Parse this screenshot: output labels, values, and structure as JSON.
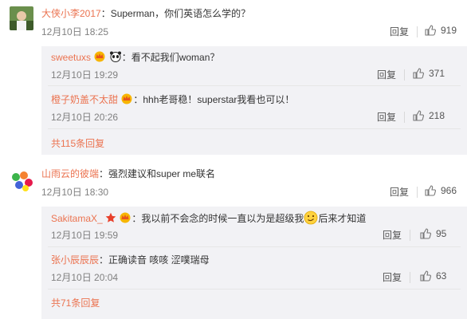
{
  "comments": [
    {
      "user": "大侠小李2017",
      "text": "：Superman，你们英语怎么学的？",
      "time": "12月10日 18:25",
      "reply_label": "回复",
      "likes": "919",
      "replies": [
        {
          "user": "sweetuxs",
          "text": "：看不起我们woman？",
          "time": "12月10日 19:29",
          "reply_label": "回复",
          "likes": "371"
        },
        {
          "user": "橙子奶盖不太甜",
          "text": "：hhh老哥稳！superstar我看也可以！",
          "time": "12月10日 20:26",
          "reply_label": "回复",
          "likes": "218"
        }
      ],
      "more_replies": "共115条回复"
    },
    {
      "user": "山雨云的彼端",
      "text": "：强烈建议和super me联名",
      "time": "12月10日 18:30",
      "reply_label": "回复",
      "likes": "966",
      "replies": [
        {
          "user": "SakitamaX_",
          "text_before": "：我以前不会念的时候一直以为是超级我",
          "text_after": "后来才知道",
          "time": "12月10日 19:59",
          "reply_label": "回复",
          "likes": "95"
        },
        {
          "user": "张小辰辰辰",
          "text": "：正确读音 咳咳 涩噗瑞母",
          "time": "12月10日 20:04",
          "reply_label": "回复",
          "likes": "63"
        }
      ],
      "more_replies": "共71条回复"
    }
  ],
  "icons": {
    "like": "thumbs-up-icon",
    "panda": "panda-emoji-icon",
    "star": "star-badge-icon",
    "vip": "vip-crown-badge-icon",
    "emoji_smirk": "smirk-emoji-icon"
  },
  "colors": {
    "username": "#eb7350",
    "text": "#333333",
    "time": "#808080",
    "subbox_bg": "#f2f2f5"
  }
}
